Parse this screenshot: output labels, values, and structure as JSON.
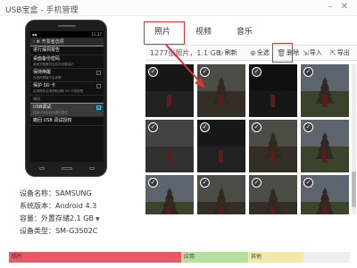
{
  "window": {
    "title": "USB宝盒 - 手机管理",
    "minimize_icon": "minimize-icon",
    "close_icon": "close-icon"
  },
  "phone": {
    "status_time": "11:27",
    "header": "开发者选项",
    "menu": [
      {
        "title": "进行漏洞报告",
        "sub": ""
      },
      {
        "title": "桌面备份密码",
        "sub": "桌面完整备份当前未设置保护"
      },
      {
        "title": "保持唤醒",
        "sub": "充电时屏幕不会休眠"
      },
      {
        "title": "保护 SD 卡",
        "sub": "应用程序必须获取读取 SD 卡的权限"
      }
    ],
    "section": "调试",
    "usb_debug": {
      "title": "USB调试",
      "sub": "连接USB后启用调试模式"
    },
    "revoke": {
      "title": "撤回 USB 调试授权",
      "sub": ""
    }
  },
  "device": {
    "name_label": "设备名称：SAMSUNG",
    "system_label": "系统版本：Android 4.3",
    "storage_label": "容量：外置存储2.1 GB",
    "type_label": "设备类型：SM-G3502C"
  },
  "tabs": [
    {
      "label": "照片",
      "active": true
    },
    {
      "label": "视频",
      "active": false
    },
    {
      "label": "音乐",
      "active": false
    }
  ],
  "toolbar": {
    "count": "1277张照片，1.1 GB",
    "refresh": "刷新",
    "select_all": "全选",
    "delete": "删除",
    "import": "导入",
    "export": "导出"
  },
  "photos": [
    {
      "checked": true,
      "scene": "night"
    },
    {
      "checked": true,
      "scene": "temple"
    },
    {
      "checked": true,
      "scene": "dark"
    },
    {
      "checked": true,
      "scene": "pagoda"
    },
    {
      "checked": true,
      "scene": "street"
    },
    {
      "checked": true,
      "scene": "night"
    },
    {
      "checked": true,
      "scene": "temple"
    },
    {
      "checked": true,
      "scene": "pagoda"
    },
    {
      "checked": true,
      "scene": "pagoda"
    },
    {
      "checked": true,
      "scene": "temple"
    },
    {
      "checked": true,
      "scene": "temple"
    },
    {
      "checked": true,
      "scene": "pagoda"
    }
  ],
  "storage_bar": {
    "photo": "照片",
    "apps": "应用",
    "other": "其他"
  },
  "colors": {
    "highlight_red": "#e03030",
    "photo_segment": "#e85a6a",
    "apps_segment": "#b5e0a0",
    "other_segment": "#f2e8a8",
    "android_accent": "#33b5e5"
  }
}
